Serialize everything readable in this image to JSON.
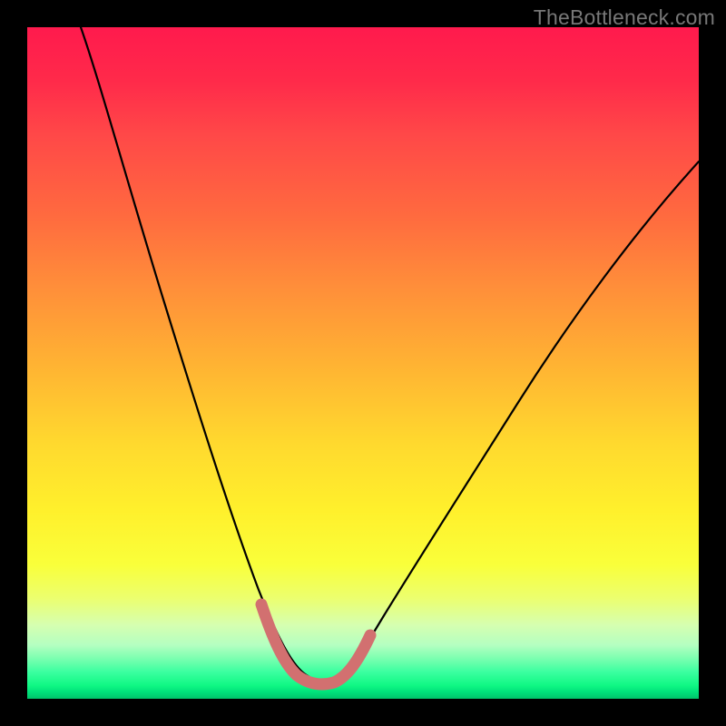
{
  "watermark": "TheBottleneck.com",
  "colors": {
    "frame": "#000000",
    "curve_stroke": "#000000",
    "highlight_stroke": "#d27070",
    "gradient_top": "#ff1a4d",
    "gradient_bottom": "#00c46a"
  },
  "chart_data": {
    "type": "line",
    "title": "",
    "xlabel": "",
    "ylabel": "",
    "xlim": [
      0,
      100
    ],
    "ylim": [
      0,
      100
    ],
    "grid": false,
    "optimal_zone_x": [
      37,
      49
    ],
    "series": [
      {
        "name": "bottleneck-curve",
        "x": [
          8,
          12,
          16,
          20,
          24,
          28,
          32,
          35,
          37,
          39,
          41,
          43,
          45,
          47,
          49,
          53,
          58,
          64,
          70,
          78,
          86,
          94,
          100
        ],
        "values": [
          100,
          88,
          76,
          64,
          52,
          40,
          28,
          18,
          11,
          7,
          5,
          4,
          4,
          5,
          7,
          13,
          21,
          30,
          40,
          52,
          63,
          73,
          80
        ]
      },
      {
        "name": "optimal-highlight",
        "x": [
          35,
          37,
          39,
          41,
          43,
          45,
          47,
          49,
          51
        ],
        "values": [
          14,
          9,
          6,
          5,
          4,
          4,
          5,
          7,
          10
        ]
      }
    ]
  }
}
